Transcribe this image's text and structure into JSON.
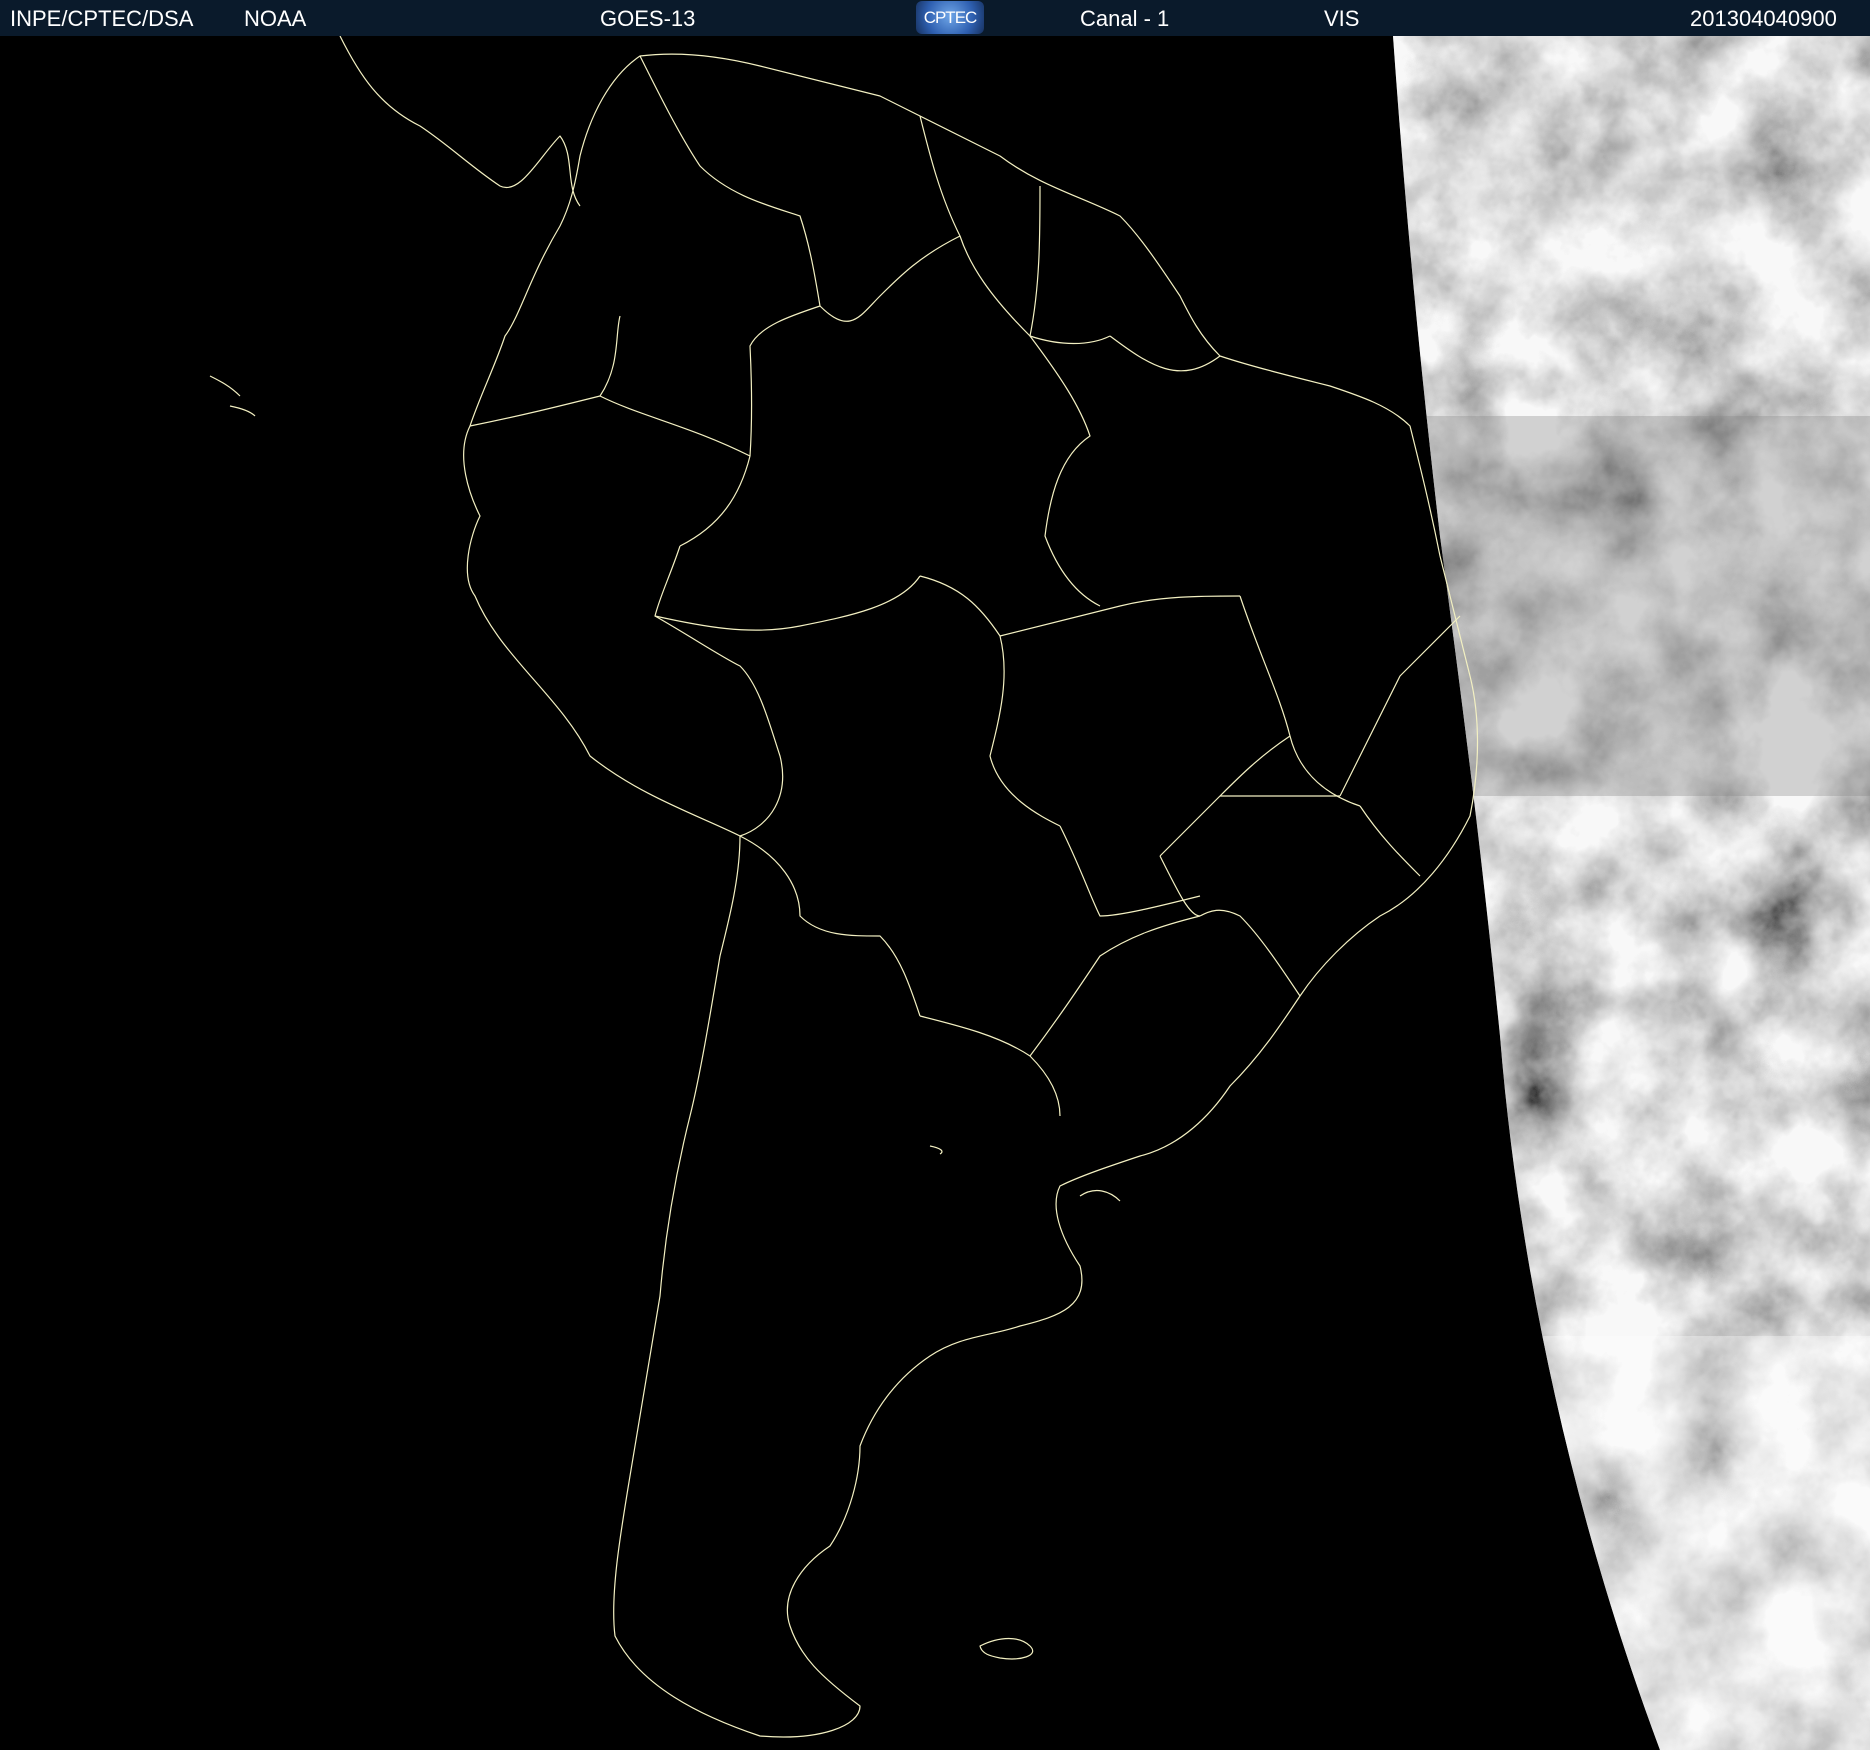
{
  "header": {
    "organization": "INPE/CPTEC/DSA",
    "agency": "NOAA",
    "satellite": "GOES-13",
    "logo_text": "CPTEC",
    "channel": "Canal - 1",
    "band": "VIS",
    "timestamp": "201304040900"
  },
  "colors": {
    "header_bg": "#0a1a2b",
    "border_lines": "#f3f0c2",
    "night_side": "#000000",
    "cloud_day_side": "#9a9a9a"
  }
}
